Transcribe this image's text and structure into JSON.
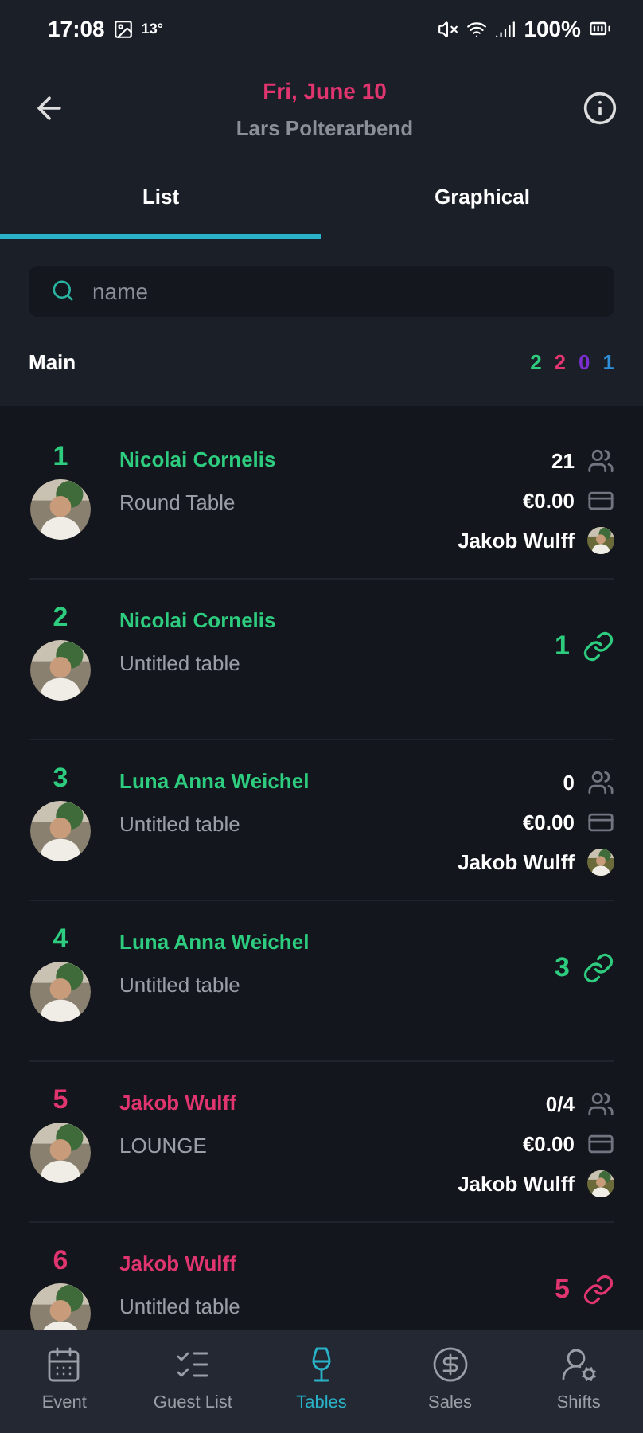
{
  "status_bar": {
    "time": "17:08",
    "temperature": "13°",
    "battery": "100%"
  },
  "header": {
    "date": "Fri, June 10",
    "event": "Lars Polterarbend"
  },
  "tabs": [
    {
      "label": "List",
      "selected": true
    },
    {
      "label": "Graphical",
      "selected": false
    }
  ],
  "search": {
    "placeholder": "name"
  },
  "section": {
    "title": "Main",
    "counts": [
      {
        "value": "2",
        "color": "#2ecc7f"
      },
      {
        "value": "2",
        "color": "#e0356f"
      },
      {
        "value": "0",
        "color": "#7b2fd0"
      },
      {
        "value": "1",
        "color": "#2f8fd8"
      }
    ]
  },
  "tables": [
    {
      "kind": "detail",
      "number": "1",
      "name": "Nicolai Cornelis",
      "table": "Round Table",
      "color": "#2ecc7f",
      "guests": "21",
      "amount": "€0.00",
      "waiter": "Jakob Wulff"
    },
    {
      "kind": "linked",
      "number": "2",
      "name": "Nicolai Cornelis",
      "table": "Untitled table",
      "color": "#2ecc7f",
      "links": "1"
    },
    {
      "kind": "detail",
      "number": "3",
      "name": "Luna Anna Weichel",
      "table": "Untitled table",
      "color": "#2ecc7f",
      "guests": "0",
      "amount": "€0.00",
      "waiter": "Jakob Wulff"
    },
    {
      "kind": "linked",
      "number": "4",
      "name": "Luna Anna Weichel",
      "table": "Untitled table",
      "color": "#2ecc7f",
      "links": "3"
    },
    {
      "kind": "detail",
      "number": "5",
      "name": "Jakob Wulff",
      "table": "LOUNGE",
      "color": "#e0356f",
      "guests": "0/4",
      "amount": "€0.00",
      "waiter": "Jakob Wulff"
    },
    {
      "kind": "linked",
      "number": "6",
      "name": "Jakob Wulff",
      "table": "Untitled table",
      "color": "#e0356f",
      "links": "5"
    }
  ],
  "nav": [
    {
      "label": "Event",
      "selected": false
    },
    {
      "label": "Guest List",
      "selected": false
    },
    {
      "label": "Tables",
      "selected": true
    },
    {
      "label": "Sales",
      "selected": false
    },
    {
      "label": "Shifts",
      "selected": false
    }
  ]
}
